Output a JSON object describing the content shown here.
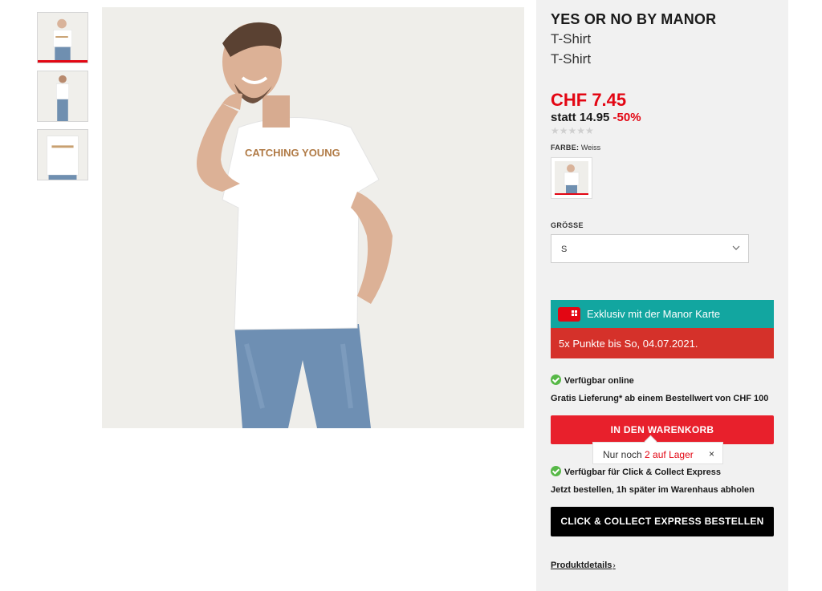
{
  "gallery": {
    "thumbnails": [
      {
        "label": "Produktbild 1",
        "active": true
      },
      {
        "label": "Produktbild 2",
        "active": false
      },
      {
        "label": "Produktbild 3",
        "active": false
      }
    ],
    "shirt_print": "CATCHING YOUNG"
  },
  "product": {
    "brand": "YES OR NO BY MANOR",
    "name_line1": "T-Shirt",
    "name_line2": "T-Shirt",
    "price": "CHF 7.45",
    "old_price_prefix": "statt 14.95",
    "discount": "-50%",
    "rating_stars": "★★★★★",
    "color_label": "FARBE:",
    "color_value": "Weiss",
    "size_label": "GRÖSSE",
    "size_value": "S"
  },
  "promo": {
    "manor_card": "Exklusiv mit der Manor Karte",
    "points": "5x Punkte bis So, 04.07.2021."
  },
  "availability": {
    "online": "Verfügbar online",
    "shipping": "Gratis Lieferung* ab einem Bestellwert von CHF 100",
    "cart_button": "IN DEN WARENKORB",
    "stock_prefix": "Nur noch",
    "stock_value": "2 auf Lager",
    "stock_close": "×",
    "click_collect": "Verfügbar für Click & Collect Express",
    "click_collect_note": "Jetzt bestellen, 1h später im Warenhaus abholen",
    "cc_button": "CLICK & COLLECT EXPRESS BESTELLEN",
    "details_link": "Produktdetails",
    "details_arrow": "›"
  },
  "colors": {
    "accent_red": "#e30613",
    "teal": "#12a6a0",
    "dark_red": "#d5312a",
    "green_check": "#57b847",
    "panel_bg": "#f1f1f1"
  }
}
